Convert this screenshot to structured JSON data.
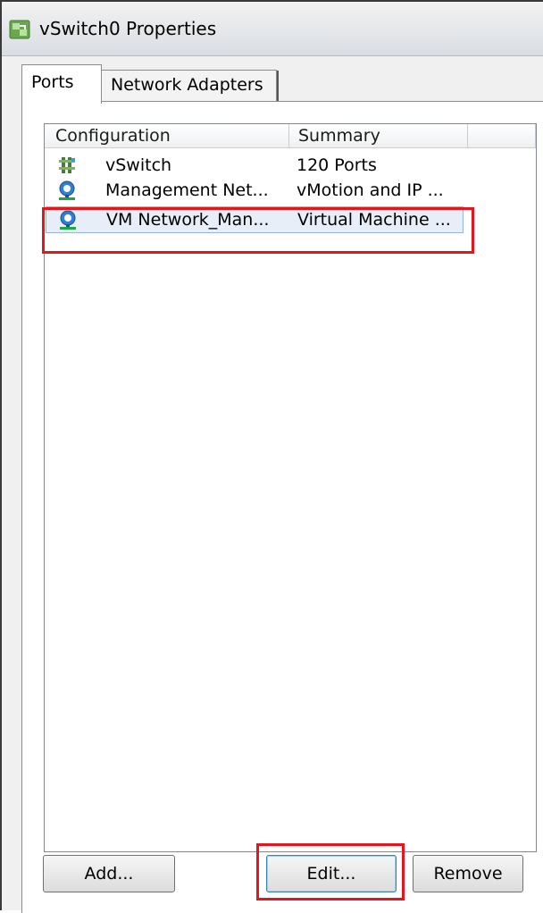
{
  "window": {
    "title": "vSwitch0 Properties",
    "icon": "vswitch-app-icon"
  },
  "tabs": [
    {
      "label": "Ports",
      "active": true
    },
    {
      "label": "Network Adapters",
      "active": false
    }
  ],
  "list": {
    "columns": [
      "Configuration",
      "Summary"
    ],
    "rows": [
      {
        "config": "vSwitch",
        "summary": "120 Ports",
        "icon": "vswitch-icon"
      },
      {
        "config": "Management Net...",
        "summary": "vMotion and IP ...",
        "icon": "portgroup-icon"
      },
      {
        "config": "VM Network_Man...",
        "summary": "Virtual Machine ...",
        "icon": "portgroup-icon",
        "selected": true
      }
    ]
  },
  "buttons": {
    "add": "Add...",
    "edit": "Edit...",
    "remove": "Remove"
  },
  "colors": {
    "highlight": "#e8141c",
    "selection": "#e8eef7"
  }
}
